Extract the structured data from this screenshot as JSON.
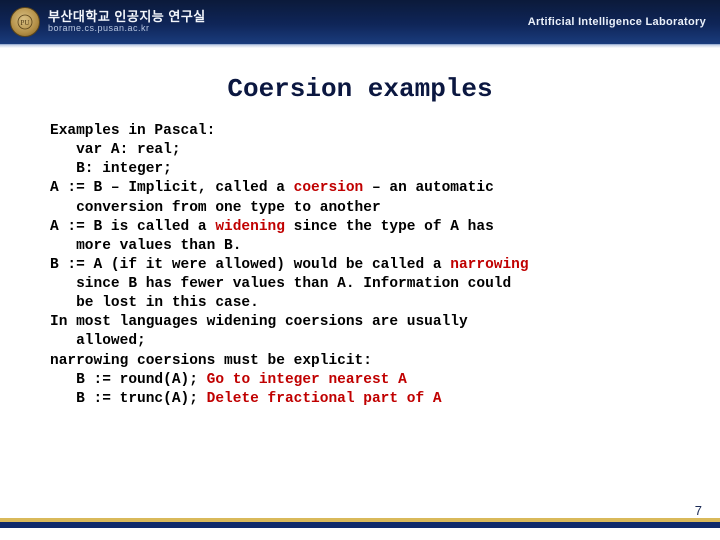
{
  "header": {
    "org_name": "부산대학교 인공지능 연구실",
    "org_url": "borame.cs.pusan.ac.kr",
    "lab_name": "Artificial Intelligence Laboratory"
  },
  "title": "Coersion examples",
  "body": {
    "l01": "Examples in Pascal:",
    "l02": "   var A: real;",
    "l03": "   B: integer;",
    "l04a": "A := B – Implicit, called a ",
    "l04b": "coersion",
    "l04c": " – an automatic",
    "l05": "   conversion from one type to another",
    "l06a": "A := B is called a ",
    "l06b": "widening",
    "l06c": " since the type of A has",
    "l07": "   more values than B.",
    "l08a": "B := A (if it were allowed) would be called a ",
    "l08b": "narrowing",
    "l09": "   since B has fewer values than A. Information could",
    "l10": "   be lost in this case.",
    "l11": "In most languages widening coersions are usually",
    "l12": "   allowed;",
    "l13": "narrowing coersions must be explicit:",
    "l14a": "   B := round(A); ",
    "l14b": "Go to integer nearest A",
    "l15a": "   B := trunc(A); ",
    "l15b": "Delete fractional part of A"
  },
  "page_number": "7"
}
